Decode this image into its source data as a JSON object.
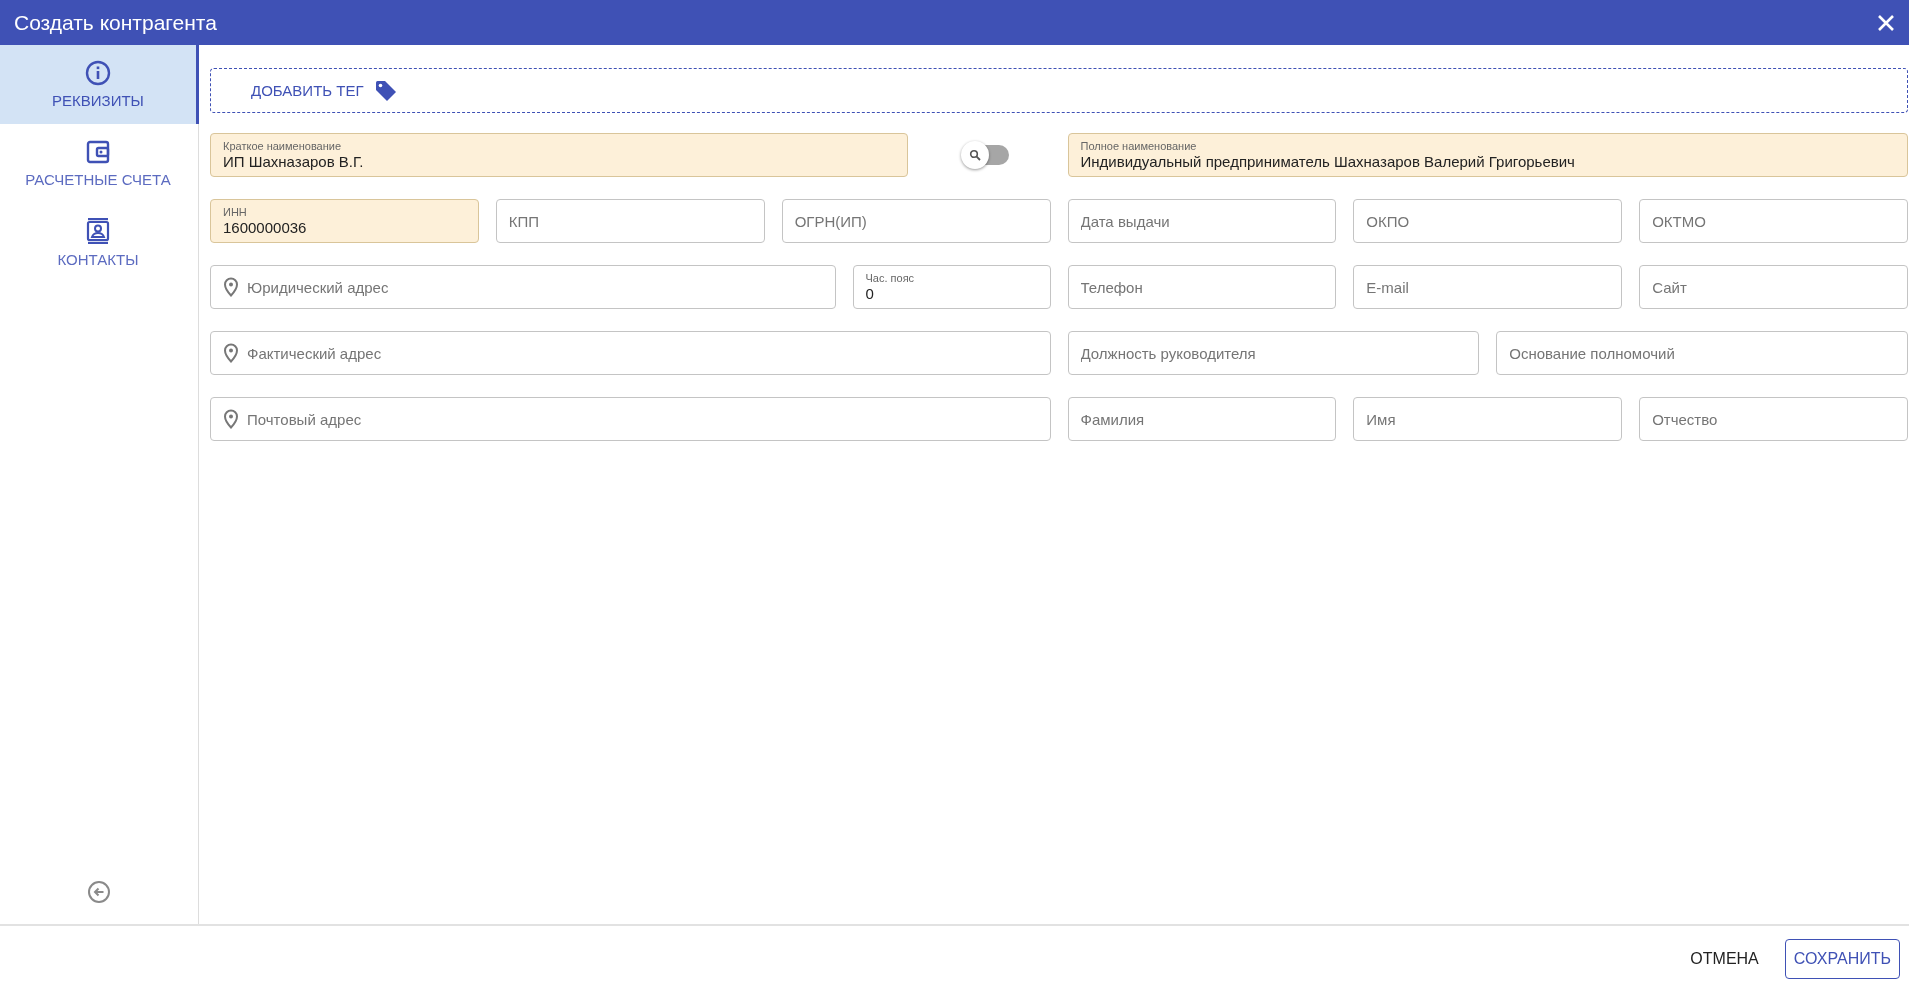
{
  "window": {
    "title": "Создать контрагента"
  },
  "sidebar": {
    "items": [
      {
        "kind": "info",
        "label": "РЕКВИЗИТЫ",
        "selected": true
      },
      {
        "kind": "wallet",
        "label": "РАСЧЕТНЫЕ СЧЕТА",
        "selected": false
      },
      {
        "kind": "contacts",
        "label": "КОНТАКТЫ",
        "selected": false
      }
    ]
  },
  "tag_area": {
    "button": "ДОБАВИТЬ ТЕГ"
  },
  "form": {
    "short_name": {
      "label": "Краткое наименование",
      "value": "ИП Шахназаров В.Г.",
      "highlighted": true
    },
    "name_search_toggle": {
      "on": false
    },
    "full_name": {
      "label": "Полное наименование",
      "value": "Индивидуальный предприниматель Шахназаров Валерий Григорьевич",
      "highlighted": true
    },
    "inn": {
      "label": "ИНН",
      "value": "1600000036",
      "highlighted": true
    },
    "kpp": {
      "placeholder": "КПП",
      "highlighted": false
    },
    "ogrn": {
      "placeholder": "ОГРН(ИП)",
      "highlighted": false
    },
    "issue_date": {
      "placeholder": "Дата выдачи",
      "highlighted": false
    },
    "okpo": {
      "placeholder": "ОКПО",
      "highlighted": false
    },
    "oktmo": {
      "placeholder": "ОКТМО",
      "highlighted": false
    },
    "legal_address": {
      "placeholder": "Юридический адрес",
      "highlighted": false
    },
    "timezone": {
      "label": "Час. пояс",
      "value": "0",
      "highlighted": false
    },
    "phone": {
      "placeholder": "Телефон",
      "highlighted": false
    },
    "email": {
      "placeholder": "E-mail",
      "highlighted": false
    },
    "site": {
      "placeholder": "Сайт",
      "highlighted": false
    },
    "actual_address": {
      "placeholder": "Фактический адрес",
      "highlighted": false
    },
    "head_position": {
      "placeholder": "Должность руководителя",
      "highlighted": false
    },
    "authority_basis": {
      "placeholder": "Основание полномочий",
      "highlighted": false
    },
    "postal_address": {
      "placeholder": "Почтовый адрес",
      "highlighted": false
    },
    "last_name": {
      "placeholder": "Фамилия",
      "highlighted": false
    },
    "first_name": {
      "placeholder": "Имя",
      "highlighted": false
    },
    "middle_name": {
      "placeholder": "Отчество",
      "highlighted": false
    }
  },
  "footer": {
    "cancel": "ОТМЕНА",
    "save": "СОХРАНИТЬ"
  }
}
